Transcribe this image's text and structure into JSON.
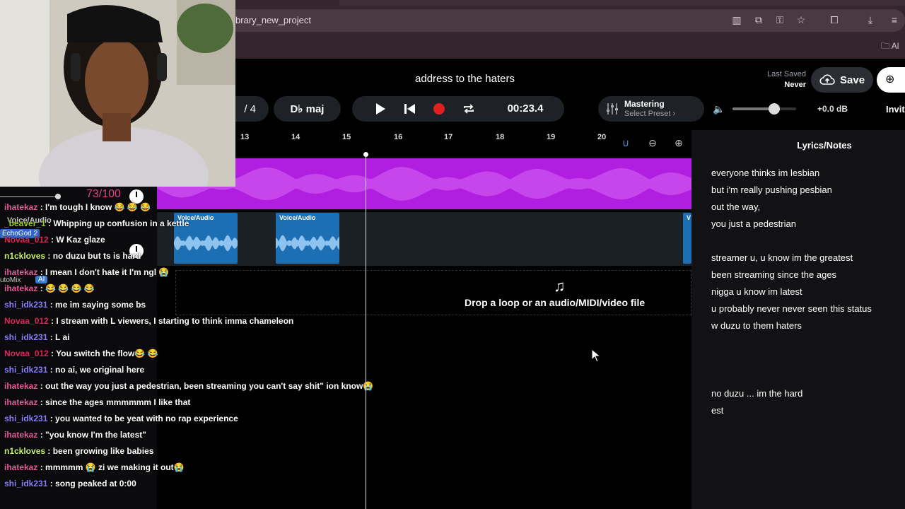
{
  "browser": {
    "url": "brary_new_project",
    "toolbar_icons": [
      "reading-mode-icon",
      "install-app-icon",
      "password-key-icon",
      "bookmark-star-icon",
      "extensions-icon",
      "download-icon",
      "menu-icon"
    ],
    "all_bookmarks_label": "Al"
  },
  "daw": {
    "project_title": "address to the haters",
    "last_saved_label": "Last Saved",
    "last_saved_value": "Never",
    "save_label": "Save",
    "time_signature": "/ 4",
    "key": "D♭ maj",
    "time": "00:23.4",
    "record_color": "#e02020",
    "mastering_label": "Mastering",
    "preset_label": "Select Preset ›",
    "master_db": "+0.0 dB",
    "master_volume_fraction": 0.65,
    "invite_label": "Invit",
    "ruler_bars": [
      "13",
      "14",
      "15",
      "16",
      "17",
      "18",
      "19",
      "20"
    ],
    "track1_color": "#b01ee0",
    "track2": {
      "name": "Voice/Audio",
      "clips": [
        {
          "label": "Voice/Audio"
        },
        {
          "label": "Voice/Audio"
        },
        {
          "label": "V"
        }
      ],
      "clip_color": "#1d6fb3"
    },
    "dropzone_text": "Drop a loop or an audio/MIDI/video file",
    "level_readout": "73/100",
    "track_tag": "EchoGod 2",
    "automix_label": "utoMix",
    "ai_badge": "AI"
  },
  "lyrics": {
    "title": "Lyrics/Notes",
    "lines": [
      "everyone thinks im lesbian",
      "but i'm really pushing pesbian",
      "out the way,",
      "you just a pedestrian",
      "",
      "streamer u, u know im the greatest",
      "been streaming since the ages",
      "nigga u know im latest",
      "u probably never never seen this status",
      "w duzu to them haters",
      "",
      "",
      "",
      "no duzu ... im the hard",
      "est"
    ]
  },
  "chat": [
    {
      "user": "ihatekaz",
      "color": "#e85a9b",
      "text": "I'm tough I know 😂 😂 😂"
    },
    {
      "user": "_beaver_1",
      "color": "#9acd32",
      "text": "Whipping up confusion in a kettle"
    },
    {
      "user": "Novaa_012",
      "color": "#e0245e",
      "text": "W Kaz glaze"
    },
    {
      "user": "n1ckloves",
      "color": "#c8f06a",
      "text": "no duzu but ts is hard"
    },
    {
      "user": "ihatekaz",
      "color": "#e85a9b",
      "text": "I mean I don't hate it I'm ngl 😭"
    },
    {
      "user": "ihatekaz",
      "color": "#e85a9b",
      "text": "😂 😂 😂 😂"
    },
    {
      "user": "shi_idk231",
      "color": "#8a7dff",
      "text": "me im saying some bs"
    },
    {
      "user": "Novaa_012",
      "color": "#e0245e",
      "text": "I stream with L viewers, I starting to think imma chameleon"
    },
    {
      "user": "shi_idk231",
      "color": "#8a7dff",
      "text": "L ai"
    },
    {
      "user": "Novaa_012",
      "color": "#e0245e",
      "text": "You switch the flow😂 😂"
    },
    {
      "user": "shi_idk231",
      "color": "#8a7dff",
      "text": "no ai, we original here"
    },
    {
      "user": "ihatekaz",
      "color": "#e85a9b",
      "text": "out the way you just a pedestrian, been streaming you can't say shit\" ion know😭"
    },
    {
      "user": "ihatekaz",
      "color": "#e85a9b",
      "text": "since the ages mmmmmm I like that"
    },
    {
      "user": "shi_idk231",
      "color": "#8a7dff",
      "text": "you wanted to be yeat with no rap experience"
    },
    {
      "user": "ihatekaz",
      "color": "#e85a9b",
      "text": "\"you know I'm the latest\""
    },
    {
      "user": "n1ckloves",
      "color": "#c8f06a",
      "text": "been growing like babies"
    },
    {
      "user": "ihatekaz",
      "color": "#e85a9b",
      "text": "mmmmm 😭 zi we making it out😭"
    },
    {
      "user": "shi_idk231",
      "color": "#8a7dff",
      "text": "song peaked at 0:00"
    }
  ]
}
